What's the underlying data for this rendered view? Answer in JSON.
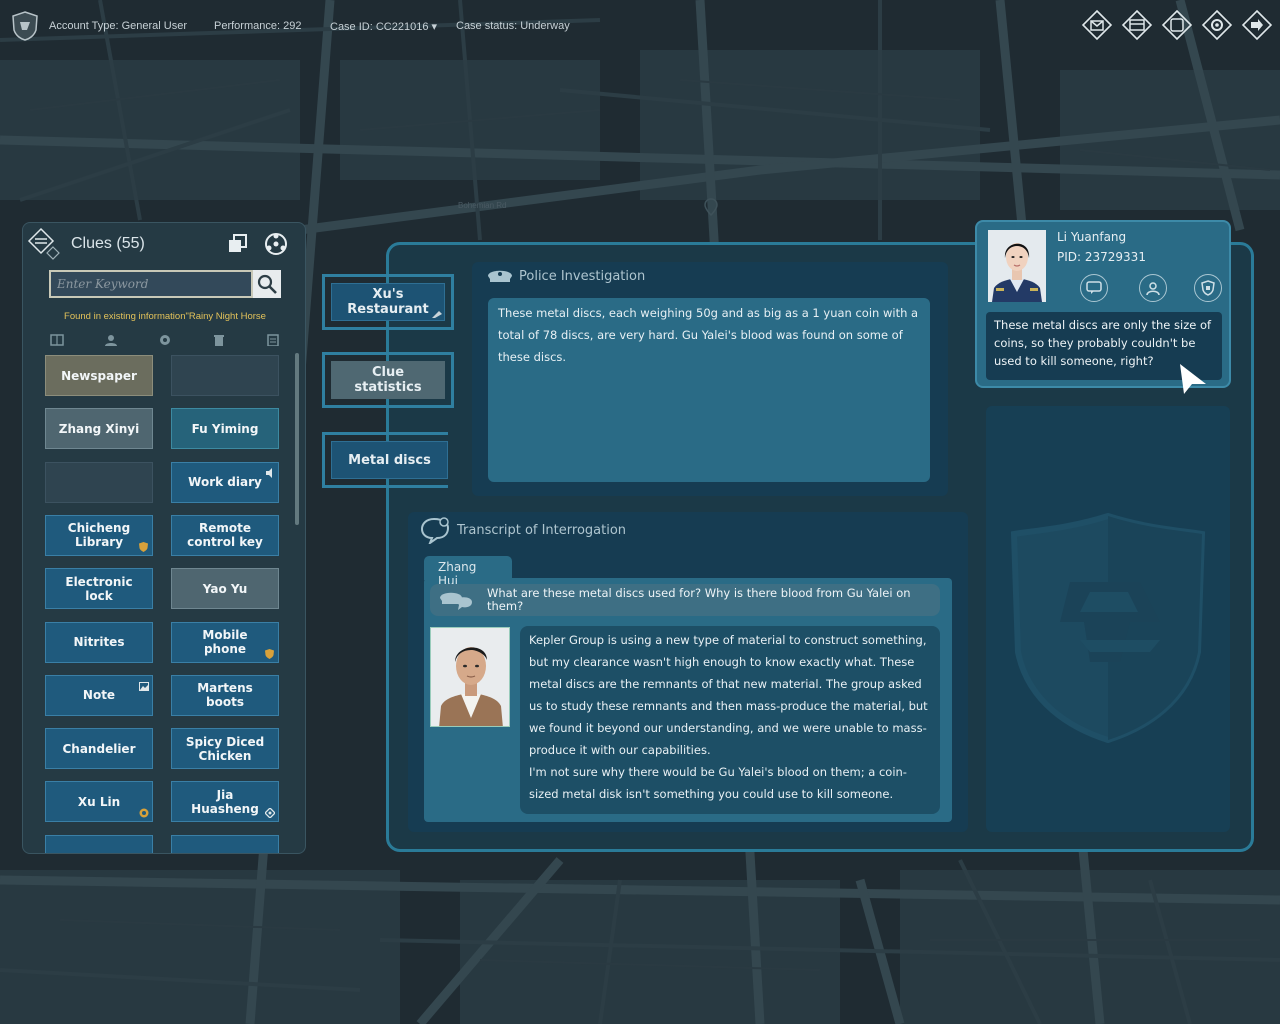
{
  "topbar": {
    "account_type": "Account Type: General User",
    "performance": "Performance: 292",
    "case_id": "Case ID: CC221016 ▾",
    "case_status": "Case status: Underway",
    "icons": [
      "mail-icon",
      "case-file-icon",
      "tablet-icon",
      "settings-icon",
      "exit-icon"
    ]
  },
  "map": {
    "street_label": "Bohemian Rd"
  },
  "clues": {
    "title": "Clues",
    "count": "(55)",
    "search_placeholder": "Enter Keyword",
    "found_note": "Found in existing information\"Rainy Night Horse",
    "filters": [
      "document-icon",
      "person-icon",
      "location-icon",
      "trash-icon",
      "clipboard-icon"
    ],
    "items": [
      {
        "label": "Newspaper",
        "style": "tan"
      },
      {
        "label": "",
        "style": "empty"
      },
      {
        "label": "Zhang Xinyi",
        "style": "gray"
      },
      {
        "label": "Fu Yiming",
        "style": "teal"
      },
      {
        "label": "",
        "style": "empty"
      },
      {
        "label": "Work diary",
        "style": "blue",
        "badge": "speaker"
      },
      {
        "label": "Chicheng Library",
        "style": "blue",
        "badge": "shield"
      },
      {
        "label": "Remote control key",
        "style": "blue"
      },
      {
        "label": "Electronic lock",
        "style": "blue"
      },
      {
        "label": "Yao Yu",
        "style": "gray"
      },
      {
        "label": "Nitrites",
        "style": "blue"
      },
      {
        "label": "Mobile phone",
        "style": "blue",
        "badge": "shield"
      },
      {
        "label": "Note",
        "style": "blue",
        "badge": "image"
      },
      {
        "label": "Martens boots",
        "style": "blue"
      },
      {
        "label": "Chandelier",
        "style": "blue"
      },
      {
        "label": "Spicy Diced Chicken",
        "style": "blue"
      },
      {
        "label": "Xu Lin",
        "style": "blue",
        "badge": "star"
      },
      {
        "label": "Jia Huasheng",
        "style": "blue",
        "badge": "diamond"
      }
    ]
  },
  "tabs": {
    "restaurant": "Xu's Restaurant",
    "statistics": "Clue statistics",
    "metal_discs": "Metal discs"
  },
  "police": {
    "title": "Police Investigation",
    "text": "These metal discs, each weighing 50g and as big as a 1 yuan coin with a total of 78 discs, are very hard. Gu Yalei's blood was found on some of these discs."
  },
  "transcript": {
    "title": "Transcript of Interrogation",
    "speaker": "Zhang Hui",
    "question": "What are these metal discs used for? Why is there blood from Gu Yalei on them?",
    "answer_1": "Kepler Group is using a new type of material to construct something, but my clearance wasn't high enough to know exactly what. These metal discs are the remnants of that new material. The group asked us to study these remnants and then mass-produce the material, but we found it beyond our understanding, and we were unable to mass-produce it with our capabilities.",
    "answer_2": "I'm not sure why there would be Gu Yalei's blood on them; a coin-sized metal disk isn't something you could use to kill someone."
  },
  "officer": {
    "name": "Li Yuanfang",
    "pid": "PID:  23729331",
    "speech": "These metal discs are only the size of coins, so they probably couldn't be used to kill someone, right?"
  },
  "colors": {
    "frame": "#2a7b98",
    "panel": "#163c52",
    "text_box": "#2a6b86",
    "clue_blue": "#1f5a7d",
    "note_yellow": "#e3c25a"
  }
}
